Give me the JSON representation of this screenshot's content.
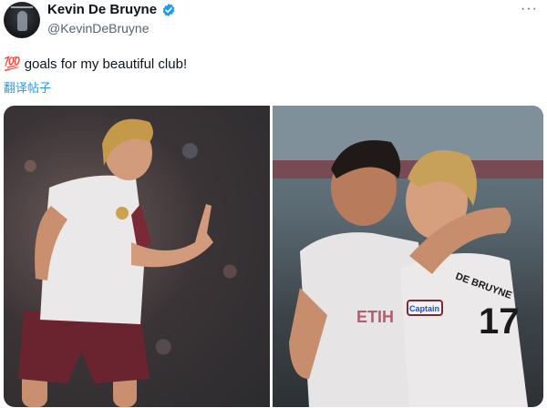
{
  "author": {
    "name": "Kevin De Bruyne",
    "handle": "@KevinDeBruyne",
    "verified_icon": "verified-badge-icon",
    "avatar_icon": "avatar"
  },
  "menu": {
    "more_label": "···"
  },
  "tweet": {
    "emoji": "💯",
    "text": "goals for my beautiful club!",
    "translate_label": "翻译帖子"
  },
  "media": {
    "photos": [
      {
        "jersey_sponsor": "",
        "jersey_number": ""
      },
      {
        "jersey_sponsor": "ETIHAD",
        "jersey_number": "17",
        "jersey_name": "DE BRUYNE",
        "armband": "Captain"
      }
    ]
  },
  "colors": {
    "accent": "#1d9bf0",
    "text_primary": "#0f1419",
    "text_secondary": "#536471",
    "jersey": "#ece9ea",
    "jersey_trim": "#7a2a36"
  }
}
